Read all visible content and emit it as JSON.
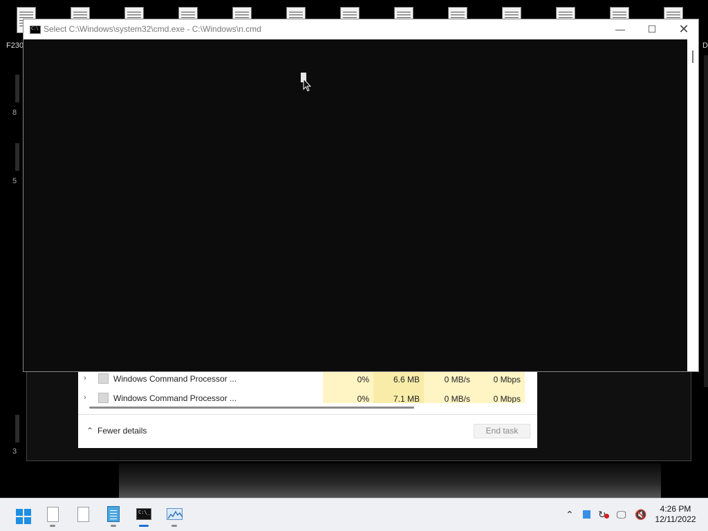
{
  "desktop": {
    "left_label": "F230",
    "right_label": "D",
    "side_numbers": [
      "8",
      "5",
      "3"
    ]
  },
  "cmd_window": {
    "title": "Select C:\\Windows\\system32\\cmd.exe - C:\\Windows\\n.cmd",
    "minimize_glyph": "—",
    "maximize_glyph": "☐",
    "close_glyph": "✕"
  },
  "task_manager": {
    "rows": [
      {
        "name": "Windows Command Processor ...",
        "cpu": "0%",
        "memory": "6.6 MB",
        "disk": "0 MB/s",
        "network": "0 Mbps"
      },
      {
        "name": "Windows Command Processor ...",
        "cpu": "0%",
        "memory": "7.1 MB",
        "disk": "0 MB/s",
        "network": "0 Mbps"
      }
    ],
    "fewer_details_label": "Fewer details",
    "end_task_label": "End task"
  },
  "taskbar": {
    "icons": [
      "windows-start-icon",
      "file-icon",
      "file-icon",
      "notepad-icon",
      "command-prompt-icon",
      "resource-monitor-icon"
    ],
    "tray_icons": [
      "chevron-up-icon",
      "blue-square-icon",
      "sync-icon",
      "monitor-icon",
      "volume-muted-icon"
    ],
    "time": "4:26 PM",
    "date": "12/11/2022"
  }
}
